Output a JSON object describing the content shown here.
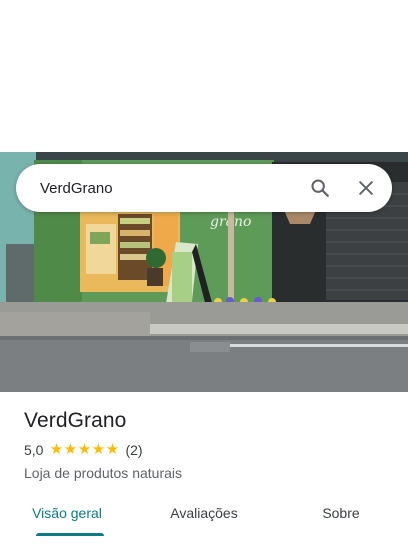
{
  "search": {
    "query": "VerdGrano"
  },
  "photo": {
    "sign_text": "grano"
  },
  "place": {
    "name": "VerdGrano",
    "rating": "5,0",
    "stars": 5,
    "review_count": "(2)",
    "category": "Loja de produtos naturais"
  },
  "tabs": [
    {
      "label": "Visão geral",
      "active": true
    },
    {
      "label": "Avaliações",
      "active": false
    },
    {
      "label": "Sobre",
      "active": false
    }
  ],
  "colors": {
    "accent": "#0b7a87",
    "star": "#fbbc04"
  },
  "icons": {
    "search": "search-icon",
    "close": "close-icon",
    "star": "star-icon"
  }
}
